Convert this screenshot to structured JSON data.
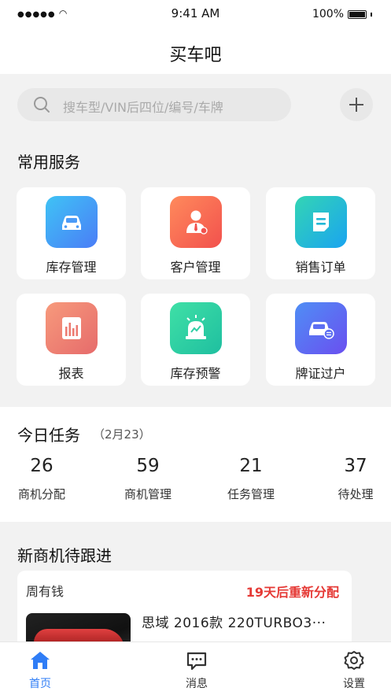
{
  "status": {
    "signal": "●●●●● ",
    "time": "9:41 AM",
    "battery": "100%"
  },
  "header": {
    "title": "买车吧"
  },
  "search": {
    "placeholder": "搜车型/VIN后四位/编号/车牌"
  },
  "services": {
    "title": "常用服务",
    "items": [
      {
        "label": "库存管理",
        "icon": "car-icon",
        "color_from": "#3fc3f5",
        "color_to": "#4a7df7"
      },
      {
        "label": "客户管理",
        "icon": "customer-icon",
        "color_from": "#ff8a5c",
        "color_to": "#f2514d"
      },
      {
        "label": "销售订单",
        "icon": "order-icon",
        "color_from": "#33d5b4",
        "color_to": "#1aa4f0"
      },
      {
        "label": "报表",
        "icon": "report-icon",
        "color_from": "#f79a7c",
        "color_to": "#e66b6b"
      },
      {
        "label": "库存预警",
        "icon": "alarm-icon",
        "color_from": "#3fe0a6",
        "color_to": "#1fbfa0"
      },
      {
        "label": "牌证过户",
        "icon": "transfer-car-icon",
        "color_from": "#4f8ef5",
        "color_to": "#6a4ff0"
      }
    ]
  },
  "tasks": {
    "title": "今日任务",
    "date": "（2月23）",
    "stats": [
      {
        "num": "26",
        "label": "商机分配"
      },
      {
        "num": "59",
        "label": "商机管理"
      },
      {
        "num": "21",
        "label": "任务管理"
      },
      {
        "num": "37",
        "label": "待处理"
      }
    ]
  },
  "leads": {
    "title": "新商机待跟进",
    "card": {
      "name": "周有钱",
      "tag": "19天后重新分配",
      "car": "思域 2016款 220TURBO3···"
    }
  },
  "tabbar": {
    "items": [
      {
        "label": "首页",
        "icon": "home-icon"
      },
      {
        "label": "消息",
        "icon": "message-icon"
      },
      {
        "label": "设置",
        "icon": "settings-icon"
      }
    ],
    "active_color": "#2f7df6"
  }
}
